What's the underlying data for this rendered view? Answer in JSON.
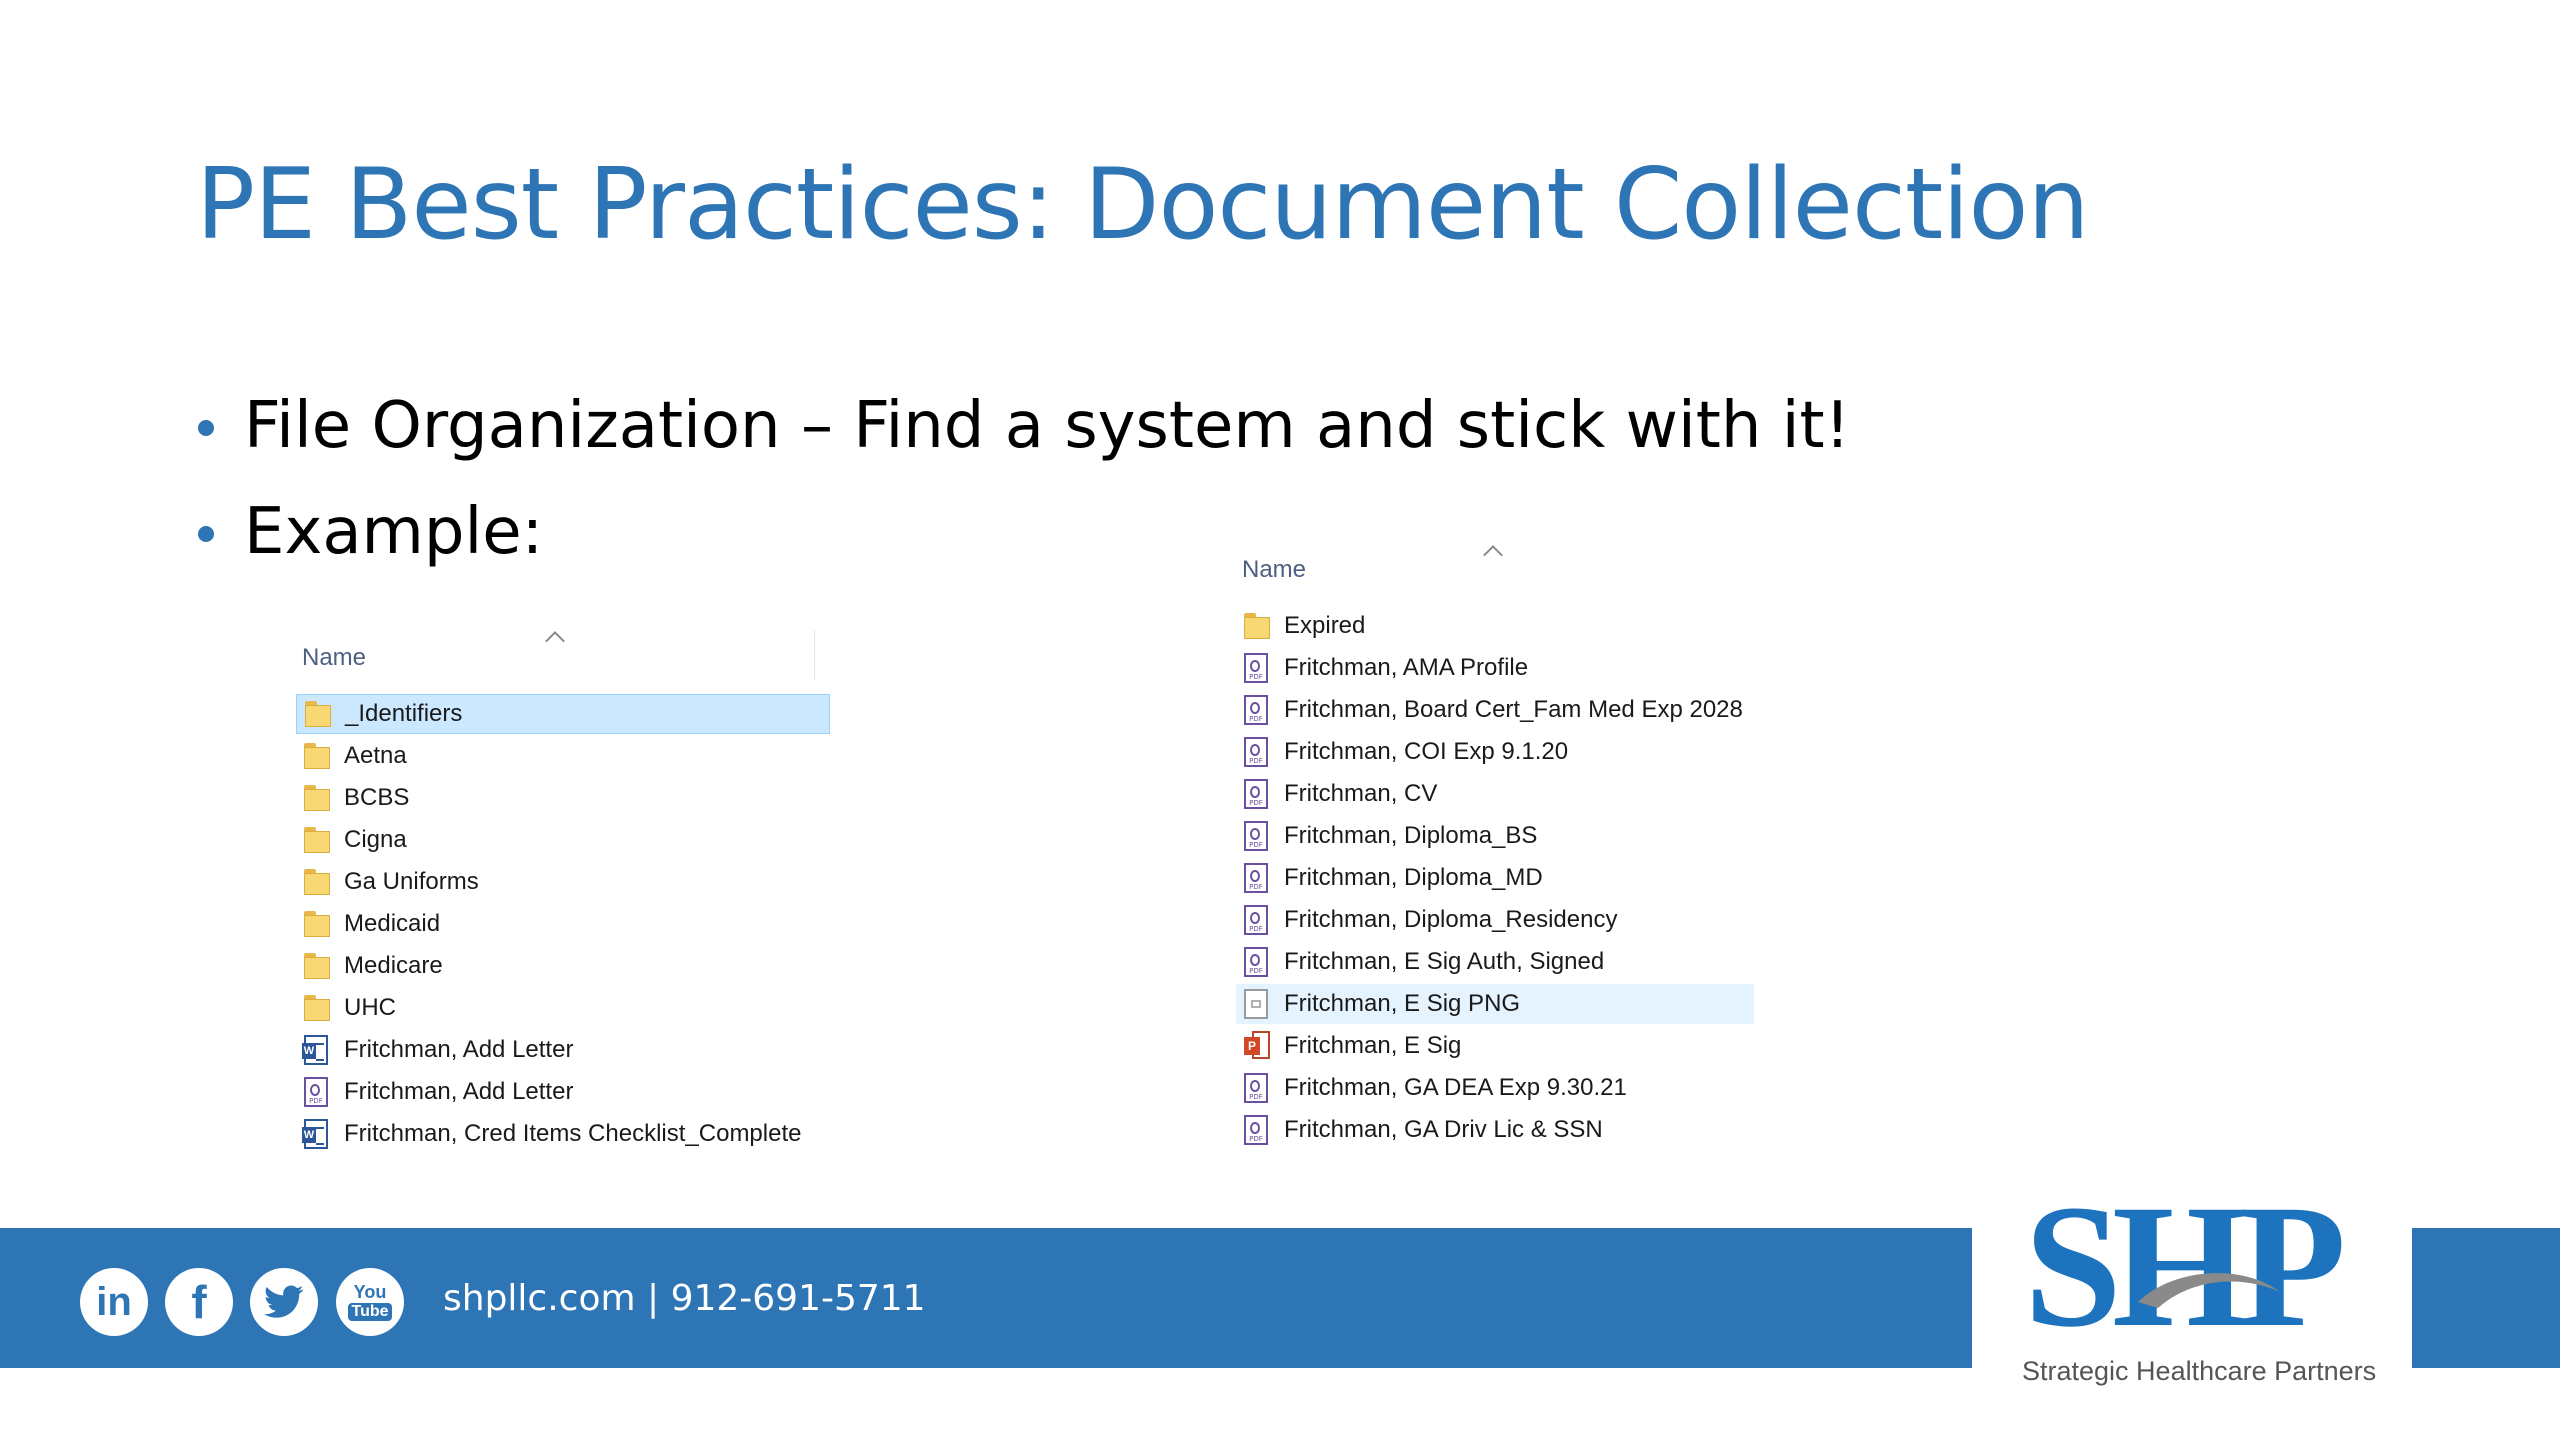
{
  "slide": {
    "title": "PE Best Practices: Document Collection",
    "bullets": [
      "File Organization – Find a system and stick with it!",
      "Example:"
    ]
  },
  "left_explorer": {
    "column_header": "Name",
    "items": [
      {
        "name": "_Identifiers",
        "icon": "folder-icon",
        "state": "selected"
      },
      {
        "name": "Aetna",
        "icon": "folder-icon"
      },
      {
        "name": "BCBS",
        "icon": "folder-icon"
      },
      {
        "name": "Cigna",
        "icon": "folder-icon"
      },
      {
        "name": "Ga Uniforms",
        "icon": "folder-icon"
      },
      {
        "name": "Medicaid",
        "icon": "folder-icon"
      },
      {
        "name": "Medicare",
        "icon": "folder-icon"
      },
      {
        "name": "UHC",
        "icon": "folder-icon"
      },
      {
        "name": "Fritchman, Add Letter",
        "icon": "word-doc-icon"
      },
      {
        "name": "Fritchman, Add Letter",
        "icon": "pdf-icon"
      },
      {
        "name": "Fritchman, Cred Items Checklist_Complete",
        "icon": "word-doc-icon"
      }
    ]
  },
  "right_explorer": {
    "column_header": "Name",
    "items": [
      {
        "name": "Expired",
        "icon": "folder-icon"
      },
      {
        "name": "Fritchman, AMA Profile",
        "icon": "pdf-icon"
      },
      {
        "name": "Fritchman, Board Cert_Fam Med Exp 2028",
        "icon": "pdf-icon"
      },
      {
        "name": "Fritchman, COI Exp 9.1.20",
        "icon": "pdf-icon"
      },
      {
        "name": "Fritchman, CV",
        "icon": "pdf-icon"
      },
      {
        "name": "Fritchman, Diploma_BS",
        "icon": "pdf-icon"
      },
      {
        "name": "Fritchman, Diploma_MD",
        "icon": "pdf-icon"
      },
      {
        "name": "Fritchman, Diploma_Residency",
        "icon": "pdf-icon"
      },
      {
        "name": "Fritchman, E Sig Auth, Signed",
        "icon": "pdf-icon"
      },
      {
        "name": "Fritchman, E Sig PNG",
        "icon": "png-image-icon",
        "state": "hover"
      },
      {
        "name": "Fritchman, E Sig",
        "icon": "powerpoint-icon"
      },
      {
        "name": "Fritchman, GA DEA Exp 9.30.21",
        "icon": "pdf-icon"
      },
      {
        "name": "Fritchman, GA Driv Lic & SSN",
        "icon": "pdf-icon"
      }
    ]
  },
  "footer": {
    "social_icons": [
      "linkedin-icon",
      "facebook-icon",
      "twitter-icon",
      "youtube-icon"
    ],
    "social_labels": {
      "linkedin": "in",
      "facebook": "f",
      "youtube_top": "You",
      "youtube_bottom": "Tube"
    },
    "contact": "shpllc.com | 912-691-5711"
  },
  "logo": {
    "letters": "SHP",
    "tagline": "Strategic Healthcare Partners"
  },
  "colors": {
    "accent": "#2e75b6",
    "selection": "#cce8ff",
    "logo_blue": "#1e73be"
  }
}
